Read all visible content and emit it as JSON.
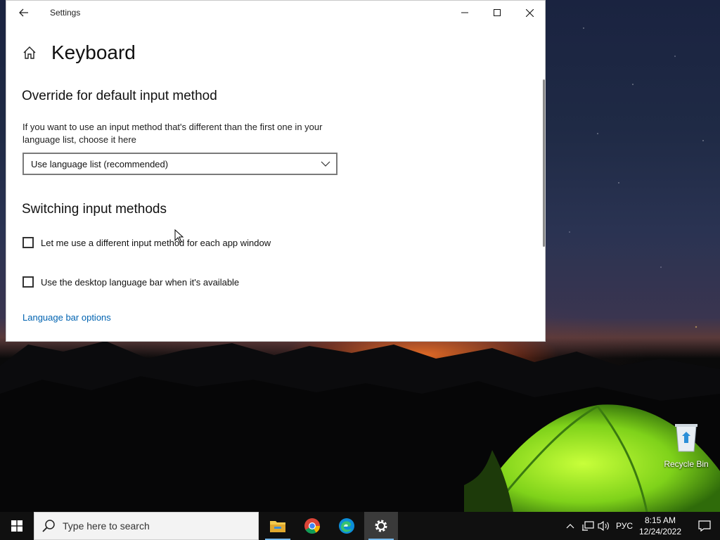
{
  "window": {
    "title": "Settings",
    "page_title": "Keyboard"
  },
  "override": {
    "heading": "Override for default input method",
    "description": "If you want to use an input method that's different than the first one in your language list, choose it here",
    "dropdown_value": "Use language list (recommended)"
  },
  "switching": {
    "heading": "Switching input methods",
    "checkbox1_label": "Let me use a different input method for each app window",
    "checkbox1_checked": false,
    "checkbox2_label": "Use the desktop language bar when it's available",
    "checkbox2_checked": false,
    "link_language_bar": "Language bar options"
  },
  "desktop": {
    "recycle_bin_label": "Recycle Bin"
  },
  "taskbar": {
    "search_placeholder": "Type here to search",
    "language_indicator": "РУС",
    "time": "8:15 AM",
    "date": "12/24/2022",
    "apps": [
      "file-explorer",
      "chrome",
      "edge",
      "settings"
    ]
  },
  "colors": {
    "link": "#0063b1",
    "taskbar": "#101010",
    "accent_underline": "#76b9ed"
  }
}
